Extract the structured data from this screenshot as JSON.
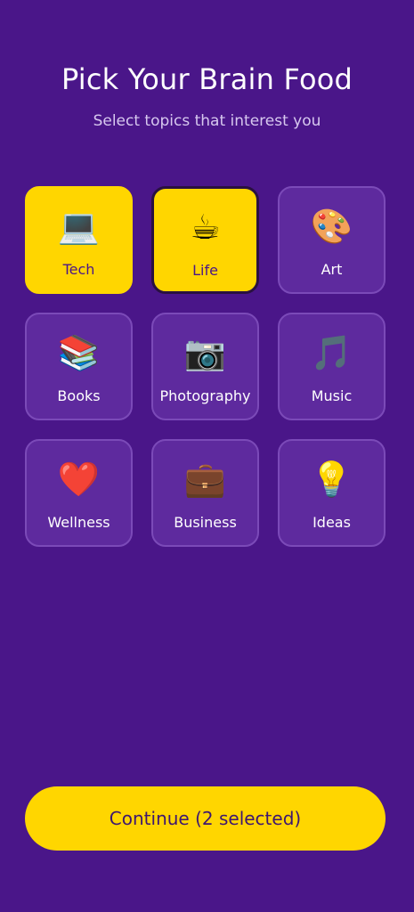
{
  "header": {
    "title": "Pick Your Brain Food",
    "subtitle": "Select topics that interest you"
  },
  "topics": [
    {
      "label": "Tech",
      "icon": "💻",
      "icon_name": "laptop-icon",
      "selected": true
    },
    {
      "label": "Life",
      "icon": "☕",
      "icon_name": "coffee-icon",
      "selected": true
    },
    {
      "label": "Art",
      "icon": "🎨",
      "icon_name": "palette-icon",
      "selected": false
    },
    {
      "label": "Books",
      "icon": "📚",
      "icon_name": "books-icon",
      "selected": false
    },
    {
      "label": "Photography",
      "icon": "📷",
      "icon_name": "camera-icon",
      "selected": false
    },
    {
      "label": "Music",
      "icon": "🎵",
      "icon_name": "music-note-icon",
      "selected": false
    },
    {
      "label": "Wellness",
      "icon": "❤️",
      "icon_name": "heart-icon",
      "selected": false
    },
    {
      "label": "Business",
      "icon": "💼",
      "icon_name": "briefcase-icon",
      "selected": false
    },
    {
      "label": "Ideas",
      "icon": "💡",
      "icon_name": "lightbulb-icon",
      "selected": false
    }
  ],
  "footer": {
    "continue_label": "Continue (2 selected)"
  },
  "colors": {
    "background": "#4a1689",
    "accent": "#ffd600",
    "tile": "#5e2a9e"
  }
}
